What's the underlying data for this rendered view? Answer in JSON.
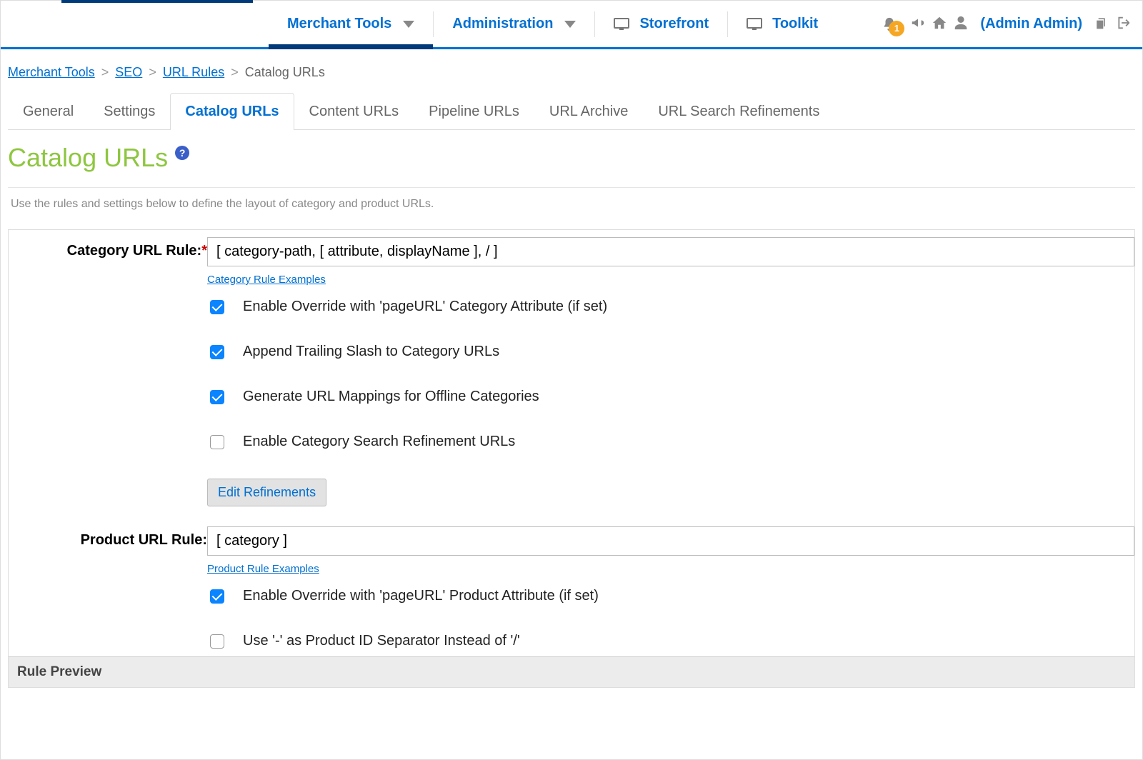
{
  "topnav": {
    "merchant_tools": "Merchant Tools",
    "administration": "Administration",
    "storefront": "Storefront",
    "toolkit": "Toolkit",
    "user_label": "(Admin Admin)",
    "badge_count": "1"
  },
  "breadcrumb": {
    "merchant_tools": "Merchant Tools",
    "seo": "SEO",
    "url_rules": "URL Rules",
    "current": "Catalog URLs"
  },
  "tabs": {
    "general": "General",
    "settings": "Settings",
    "catalog_urls": "Catalog URLs",
    "content_urls": "Content URLs",
    "pipeline_urls": "Pipeline URLs",
    "url_archive": "URL Archive",
    "url_search_refinements": "URL Search Refinements"
  },
  "page": {
    "title": "Catalog URLs",
    "help": "?",
    "description": "Use the rules and settings below to define the layout of category and product URLs."
  },
  "form": {
    "category_rule_label": "Category URL Rule:",
    "category_rule_value": "[ category-path, [ attribute, displayName ], / ]",
    "category_examples": "Category Rule Examples",
    "chk_pageurl_cat": "Enable Override with 'pageURL' Category Attribute (if set)",
    "chk_trailing_slash": "Append Trailing Slash to Category URLs",
    "chk_offline_mappings": "Generate URL Mappings for Offline Categories",
    "chk_search_refinement": "Enable Category Search Refinement URLs",
    "edit_refinements": "Edit Refinements",
    "product_rule_label": "Product URL Rule:",
    "product_rule_value": "[ category ]",
    "product_examples": "Product Rule Examples",
    "chk_pageurl_prod": "Enable Override with 'pageURL' Product Attribute (if set)",
    "chk_dash_separator": "Use '-' as Product ID Separator Instead of '/'",
    "rule_preview": "Rule Preview"
  }
}
